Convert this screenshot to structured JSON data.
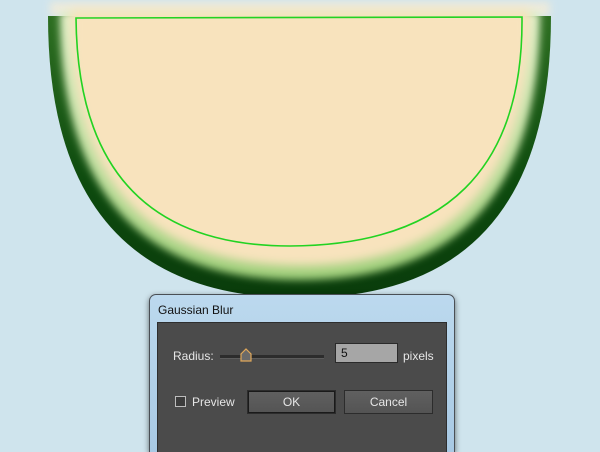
{
  "dialog": {
    "title": "Gaussian Blur",
    "radius_label": "Radius:",
    "radius_value": "5",
    "unit_label": "pixels",
    "slider_fraction": 0.25,
    "preview_label": "Preview",
    "preview_checked": false,
    "ok_label": "OK",
    "cancel_label": "Cancel"
  },
  "colors": {
    "background": "#cfe4ed",
    "rind_dark": "#0f4a10",
    "rind_mid": "#4a8f3c",
    "flesh": "#f8e3bd",
    "selection_path": "#22d322",
    "dialog_body": "#4b4b4b",
    "slider_thumb": "#e0a85a"
  }
}
